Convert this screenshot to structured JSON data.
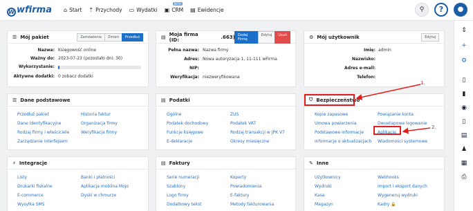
{
  "app": {
    "logo_text": "wfirma"
  },
  "nav": [
    {
      "label": "Start",
      "icon": "home-icon"
    },
    {
      "label": "Przychody",
      "icon": "income-icon"
    },
    {
      "label": "Wydatki",
      "icon": "wallet-icon"
    },
    {
      "label": "CRM",
      "icon": "crm-icon",
      "badge": "BETA"
    },
    {
      "label": "Ewidencje",
      "icon": "folder-icon"
    }
  ],
  "package": {
    "title": "Mój pakiet",
    "buttons": {
      "orders": "Zamówienia",
      "change": "Zmień",
      "extend": "Przedłuż"
    },
    "rows": [
      {
        "k": "Nazwa:",
        "v": "Księgowość online"
      },
      {
        "k": "Ważny do:",
        "v": "2023-07-23 (pozostało dni: 30)"
      },
      {
        "k": "Wykorzystanie:",
        "v": ""
      },
      {
        "k": "Aktywne dodatki:",
        "v": "0 zobacz dodatki"
      }
    ],
    "usage_fraction": 0.02
  },
  "company": {
    "title": "Moja firma (ID:",
    "id_suffix": ".663)",
    "buttons": {
      "add": "Dodaj Firmę",
      "edit": "Edytuj",
      "delete": "Usuń"
    },
    "rows": [
      {
        "k": "Pełna nazwa:",
        "v": "Nazwa firmy"
      },
      {
        "k": "Adres:",
        "v": "Nowa autoryzacja 1, 11-111 wFirma"
      },
      {
        "k": "NIP:",
        "v": ""
      },
      {
        "k": "Weryfikacja:",
        "v": "niezweryfikowana"
      }
    ]
  },
  "user": {
    "title": "Mój użytkownik",
    "buttons": {
      "edit": "Edytuj"
    },
    "rows": [
      {
        "k": "Imię:",
        "v": "admin"
      },
      {
        "k": "Nazwisko:",
        "v": ""
      },
      {
        "k": "Adres e-mail:",
        "v": ""
      },
      {
        "k": "Telefon:",
        "v": ""
      }
    ]
  },
  "basic": {
    "title": "Dane podstawowe",
    "col1": [
      "Przedłuż pakiet",
      "Dane identyfikacyjne",
      "Rodzaj firmy i właściciele",
      "Zarządzanie interfejsem"
    ],
    "col2": [
      "Historia faktur",
      "Organizacja firmy",
      "Weryfikacja firmy"
    ]
  },
  "taxes": {
    "title": "Podatki",
    "col1": [
      "Ogólne",
      "Podatek dochodowy",
      "Funkcje księgowe",
      "E-deklaracje"
    ],
    "col2": [
      "ZUS",
      "Podatek VAT",
      "Rodzaj transakcji w JPK V7",
      "Okresy miesięczne"
    ]
  },
  "security": {
    "title": "Bezpieczeństwo",
    "col1": [
      "Kopie zapasowe",
      "Umowa powierzenia",
      "Podstawowe informacje",
      "Informacje o aktualizacjach"
    ],
    "col2": [
      "Powiązanie konta",
      "Dwuetapowe logowanie",
      "Aplikacje",
      "Wiadomości systemowe"
    ]
  },
  "integrations": {
    "title": "Integracje",
    "col1": [
      "Listy",
      "Drukarki fiskalne",
      "E-commerce",
      "Wysyłka SMS"
    ],
    "col2": [
      "Banki i płatności",
      "Aplikacja mobilna Mojo",
      "Dyski w chmurze"
    ]
  },
  "invoices": {
    "title": "Faktury",
    "col1": [
      "Serie numeracji",
      "Szablony",
      "Logo firmy",
      "Dodatkowy tekst"
    ],
    "col2": [
      "Koperty",
      "Powiadomienia",
      "E-faktury",
      "Metody fakturowania"
    ]
  },
  "other": {
    "title": "Inne",
    "col1": [
      "Użytkownicy",
      "Wydruki",
      "Kasa",
      "Magazyn"
    ],
    "col2": [
      "Webhooks",
      "Import i eksport danych",
      "Wygeneruj wydruki",
      "Kadry 🔒"
    ]
  },
  "annotations": {
    "one": "1.",
    "two": "2."
  }
}
